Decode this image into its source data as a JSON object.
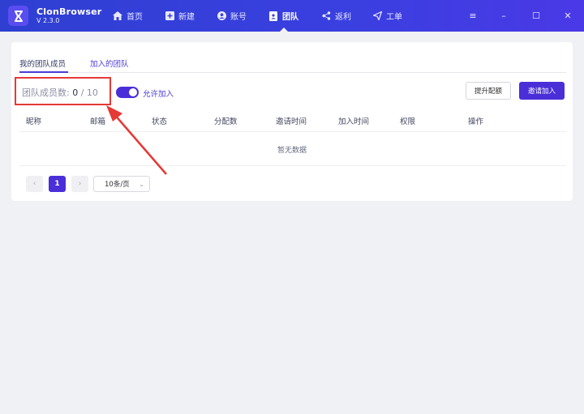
{
  "app": {
    "name": "ClonBrowser",
    "version": "V 2.3.0"
  },
  "nav": {
    "items": [
      {
        "label": "首页",
        "icon": "home-icon"
      },
      {
        "label": "新建",
        "icon": "plus-square-icon"
      },
      {
        "label": "账号",
        "icon": "user-circle-icon"
      },
      {
        "label": "团队",
        "icon": "team-badge-icon",
        "active": true
      },
      {
        "label": "返利",
        "icon": "share-icon"
      },
      {
        "label": "工单",
        "icon": "send-icon"
      }
    ]
  },
  "window": {
    "menu": "≡",
    "minimize": "–",
    "maximize": "☐",
    "close": "✕"
  },
  "tabs": {
    "my_members": "我的团队成员",
    "joined_teams": "加入的团队"
  },
  "members": {
    "label": "团队成员数:",
    "current": "0",
    "separator": " / ",
    "max": "10"
  },
  "toggle": {
    "label": "允许加入",
    "on": true
  },
  "buttons": {
    "upgrade": "提升配额",
    "invite": "邀请加入"
  },
  "table": {
    "headers": [
      "昵称",
      "邮箱",
      "状态",
      "分配数",
      "邀请时间",
      "加入时间",
      "权限",
      "操作"
    ],
    "empty_text": "暂无数据"
  },
  "pagination": {
    "prev": "‹",
    "current_page": "1",
    "next": "›",
    "page_size": "10条/页"
  },
  "colors": {
    "accent": "#4a2fd8",
    "titlebar": "#3a3fe0",
    "highlight": "#e53935"
  }
}
